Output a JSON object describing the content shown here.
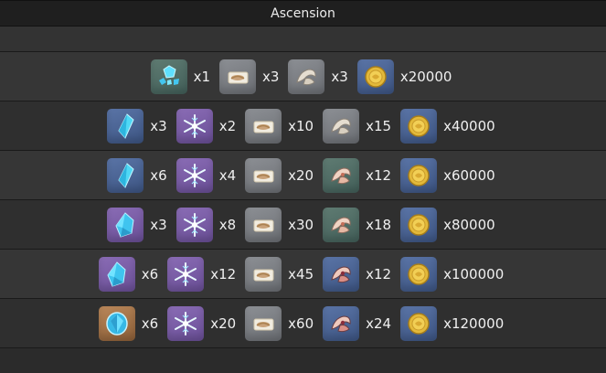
{
  "header": {
    "title": "Ascension"
  },
  "icons": {
    "chunk": "ice-crystal-chunk-icon",
    "sliver": "ice-crystal-sliver-icon",
    "fragment": "ice-crystal-fragment-icon",
    "gemstone": "ice-crystal-gemstone-icon",
    "snowflake": "snowflake-specialty-icon",
    "scroll": "scroll-material-icon",
    "horn1": "horn-material-icon",
    "horn2": "horn-material-tier2-icon",
    "horn3": "horn-material-tier3-icon",
    "coin": "mora-coin-icon"
  },
  "rows": [
    {
      "items": [
        {
          "icon": "chunk",
          "qty": "x1"
        },
        {
          "icon": "scroll",
          "qty": "x3"
        },
        {
          "icon": "horn1",
          "qty": "x3"
        },
        {
          "icon": "coin",
          "qty": "x20000"
        }
      ]
    },
    {
      "items": [
        {
          "icon": "sliver",
          "qty": "x3"
        },
        {
          "icon": "snowflake",
          "qty": "x2"
        },
        {
          "icon": "scroll",
          "qty": "x10"
        },
        {
          "icon": "horn1",
          "qty": "x15"
        },
        {
          "icon": "coin",
          "qty": "x40000"
        }
      ]
    },
    {
      "items": [
        {
          "icon": "sliver",
          "qty": "x6"
        },
        {
          "icon": "snowflake",
          "qty": "x4"
        },
        {
          "icon": "scroll",
          "qty": "x20"
        },
        {
          "icon": "horn2",
          "qty": "x12"
        },
        {
          "icon": "coin",
          "qty": "x60000"
        }
      ]
    },
    {
      "items": [
        {
          "icon": "fragment",
          "qty": "x3"
        },
        {
          "icon": "snowflake",
          "qty": "x8"
        },
        {
          "icon": "scroll",
          "qty": "x30"
        },
        {
          "icon": "horn2",
          "qty": "x18"
        },
        {
          "icon": "coin",
          "qty": "x80000"
        }
      ]
    },
    {
      "items": [
        {
          "icon": "fragment",
          "qty": "x6"
        },
        {
          "icon": "snowflake",
          "qty": "x12"
        },
        {
          "icon": "scroll",
          "qty": "x45"
        },
        {
          "icon": "horn3",
          "qty": "x12"
        },
        {
          "icon": "coin",
          "qty": "x100000"
        }
      ]
    },
    {
      "items": [
        {
          "icon": "gemstone",
          "qty": "x6"
        },
        {
          "icon": "snowflake",
          "qty": "x20"
        },
        {
          "icon": "scroll",
          "qty": "x60"
        },
        {
          "icon": "horn3",
          "qty": "x24"
        },
        {
          "icon": "coin",
          "qty": "x120000"
        }
      ]
    }
  ]
}
